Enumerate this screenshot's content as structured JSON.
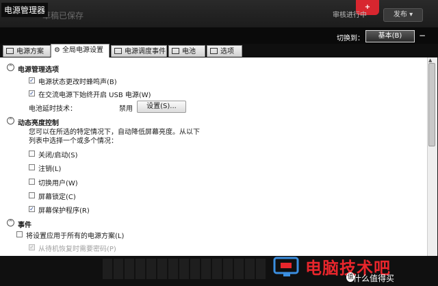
{
  "background_app": {
    "saved_status": "草稿已保存",
    "right_text": "审核进行中",
    "help_label": "发布 ▾"
  },
  "window": {
    "title": "电源管理器"
  },
  "header": {
    "switch_label": "切换到：",
    "basic_button": "基本(B)"
  },
  "tabs": [
    {
      "label": "电源方案",
      "icon": "battery-plan-icon"
    },
    {
      "label": "全局电源设置",
      "icon": "gear-icon",
      "active": true
    },
    {
      "label": "电源调度事件",
      "icon": "schedule-icon"
    },
    {
      "label": "电池",
      "icon": "battery-icon"
    },
    {
      "label": "选项",
      "icon": "checkbox-icon"
    }
  ],
  "power_options": {
    "title": "电源管理选项",
    "beep": {
      "label": "电源状态更改时蜂鸣声(B)",
      "checked": true
    },
    "usb": {
      "label": "在交流电源下始终开启 USB 电源(W)",
      "checked": true
    },
    "battery_extend": {
      "label": "电池延时技术：",
      "value": "禁用",
      "button": "设置(S)..."
    }
  },
  "dynamic_brightness": {
    "title": "动态亮度控制",
    "description_1": "您可以在所选的特定情况下，自动降低屏幕亮度。从以下",
    "description_2": "列表中选择一个或多个情况：",
    "items": [
      {
        "label": "关闭/启动(S)",
        "checked": false
      },
      {
        "label": "注销(L)",
        "checked": false
      },
      {
        "label": "切换用户(W)",
        "checked": false
      },
      {
        "label": "屏幕锁定(C)",
        "checked": false
      },
      {
        "label": "屏幕保护程序(R)",
        "checked": true
      }
    ]
  },
  "events": {
    "title": "事件",
    "apply_all": {
      "label": "将设置应用于所有的电源方案(L)",
      "checked": false
    },
    "password": {
      "label": "从待机恢复时需要密码(P)",
      "checked": true,
      "disabled": true
    }
  },
  "watermark": {
    "logo_text": "电脑技术吧",
    "site_text": "什么值得买",
    "badge": "值"
  },
  "colors": {
    "accent_red": "#e8262c",
    "check_blue": "#1a3d8f"
  }
}
